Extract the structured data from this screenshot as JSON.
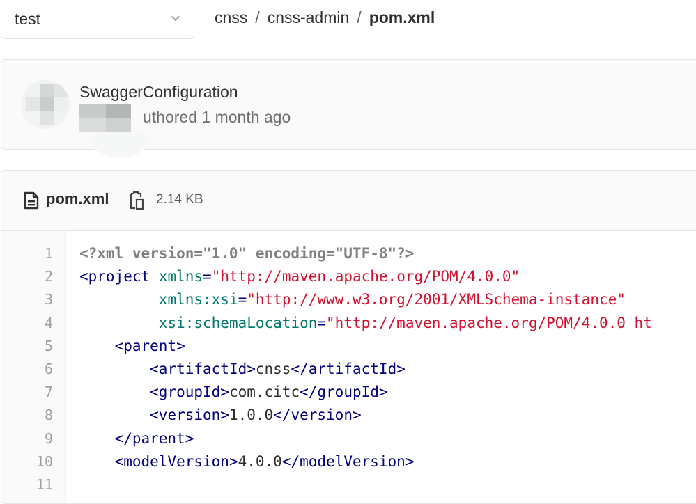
{
  "branch": {
    "name": "test"
  },
  "breadcrumb": {
    "parts": [
      "cnss",
      "cnss-admin"
    ],
    "current": "pom.xml",
    "separator": "/"
  },
  "commit": {
    "title": "SwaggerConfiguration",
    "meta": "uthored 1 month ago"
  },
  "file": {
    "name": "pom.xml",
    "size": "2.14 KB"
  },
  "colors": {
    "tag": "#000080",
    "attr": "#00796b",
    "string": "#d1112f",
    "pi": "#808080",
    "line_number": "#a0a0a0"
  },
  "code": {
    "line_numbers": [
      "1",
      "2",
      "3",
      "4",
      "5",
      "6",
      "7",
      "8",
      "9",
      "10",
      "11"
    ],
    "lines": [
      [
        {
          "t": "pi",
          "v": "<?xml version=\"1.0\" encoding=\"UTF-8\"?>"
        }
      ],
      [
        {
          "t": "tag",
          "v": "<project"
        },
        {
          "t": "txt",
          "v": " "
        },
        {
          "t": "attr",
          "v": "xmlns"
        },
        {
          "t": "tag",
          "v": "="
        },
        {
          "t": "str",
          "v": "\"http://maven.apache.org/POM/4.0.0\""
        }
      ],
      [
        {
          "t": "txt",
          "v": "         "
        },
        {
          "t": "attr",
          "v": "xmlns:xsi"
        },
        {
          "t": "tag",
          "v": "="
        },
        {
          "t": "str",
          "v": "\"http://www.w3.org/2001/XMLSchema-instance\""
        }
      ],
      [
        {
          "t": "txt",
          "v": "         "
        },
        {
          "t": "attr",
          "v": "xsi:schemaLocation"
        },
        {
          "t": "tag",
          "v": "="
        },
        {
          "t": "str",
          "v": "\"http://maven.apache.org/POM/4.0.0 ht"
        }
      ],
      [
        {
          "t": "txt",
          "v": "    "
        },
        {
          "t": "tag",
          "v": "<parent>"
        }
      ],
      [
        {
          "t": "txt",
          "v": "        "
        },
        {
          "t": "tag",
          "v": "<artifactId>"
        },
        {
          "t": "txt",
          "v": "cnss"
        },
        {
          "t": "tag",
          "v": "</artifactId>"
        }
      ],
      [
        {
          "t": "txt",
          "v": "        "
        },
        {
          "t": "tag",
          "v": "<groupId>"
        },
        {
          "t": "txt",
          "v": "com.citc"
        },
        {
          "t": "tag",
          "v": "</groupId>"
        }
      ],
      [
        {
          "t": "txt",
          "v": "        "
        },
        {
          "t": "tag",
          "v": "<version>"
        },
        {
          "t": "txt",
          "v": "1.0.0"
        },
        {
          "t": "tag",
          "v": "</version>"
        }
      ],
      [
        {
          "t": "txt",
          "v": "    "
        },
        {
          "t": "tag",
          "v": "</parent>"
        }
      ],
      [
        {
          "t": "txt",
          "v": "    "
        },
        {
          "t": "tag",
          "v": "<modelVersion>"
        },
        {
          "t": "txt",
          "v": "4.0.0"
        },
        {
          "t": "tag",
          "v": "</modelVersion>"
        }
      ],
      []
    ]
  }
}
